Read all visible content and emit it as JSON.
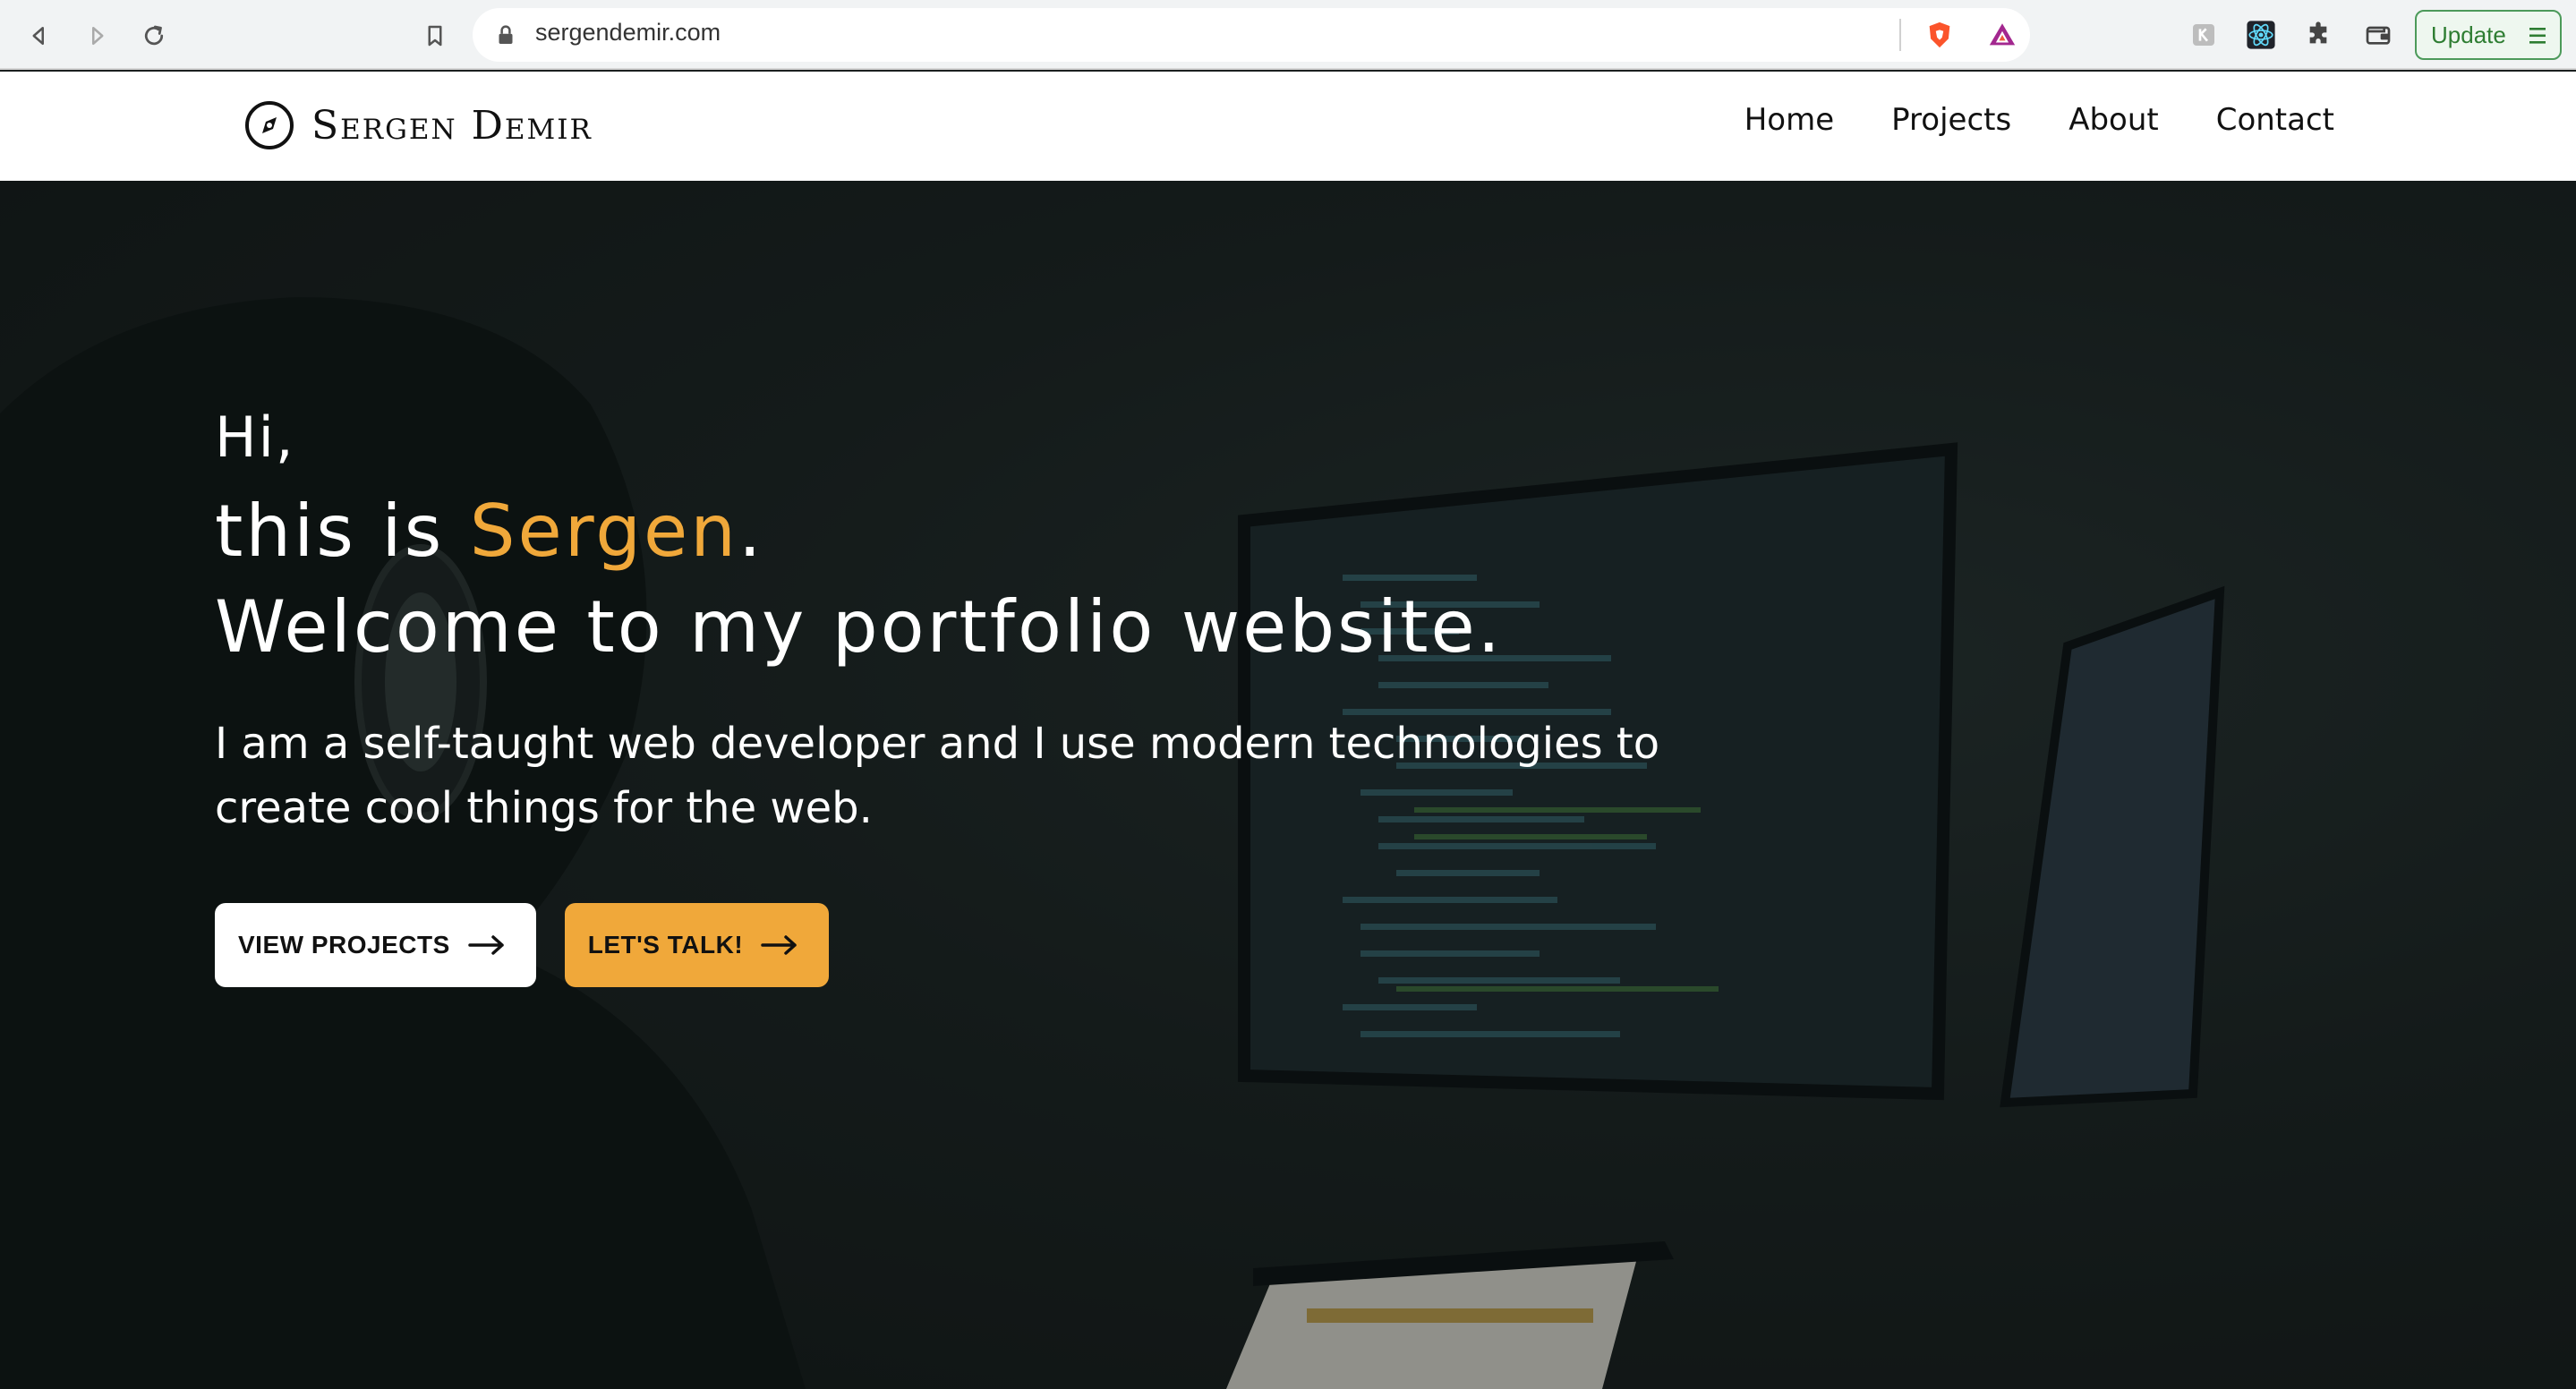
{
  "browser": {
    "url": "sergendemir.com",
    "update_label": "Update",
    "icons": [
      "back-icon",
      "forward-icon",
      "reload-icon",
      "bookmark-icon",
      "lock-icon",
      "brave-shield-icon",
      "brave-rewards-icon",
      "extension-k-icon",
      "react-devtools-icon",
      "extensions-puzzle-icon",
      "wallet-icon",
      "menu-icon"
    ]
  },
  "site": {
    "logo_text": "Sergen Demir",
    "nav": {
      "home": "Home",
      "projects": "Projects",
      "about": "About",
      "contact": "Contact"
    }
  },
  "hero": {
    "greeting": "Hi,",
    "intro_prefix": "this is ",
    "name": "Sergen",
    "intro_suffix": ".",
    "welcome": "Welcome to my portfolio website.",
    "description": "I am a self-taught web developer and I use modern technologies to create cool things for the web.",
    "view_projects_label": "VIEW PROJECTS",
    "lets_talk_label": "LET'S TALK!"
  },
  "colors": {
    "accent": "#f0a83a",
    "header_bg": "#ffffff",
    "hero_bg": "#1b2221",
    "update_green": "#2e7d32"
  }
}
